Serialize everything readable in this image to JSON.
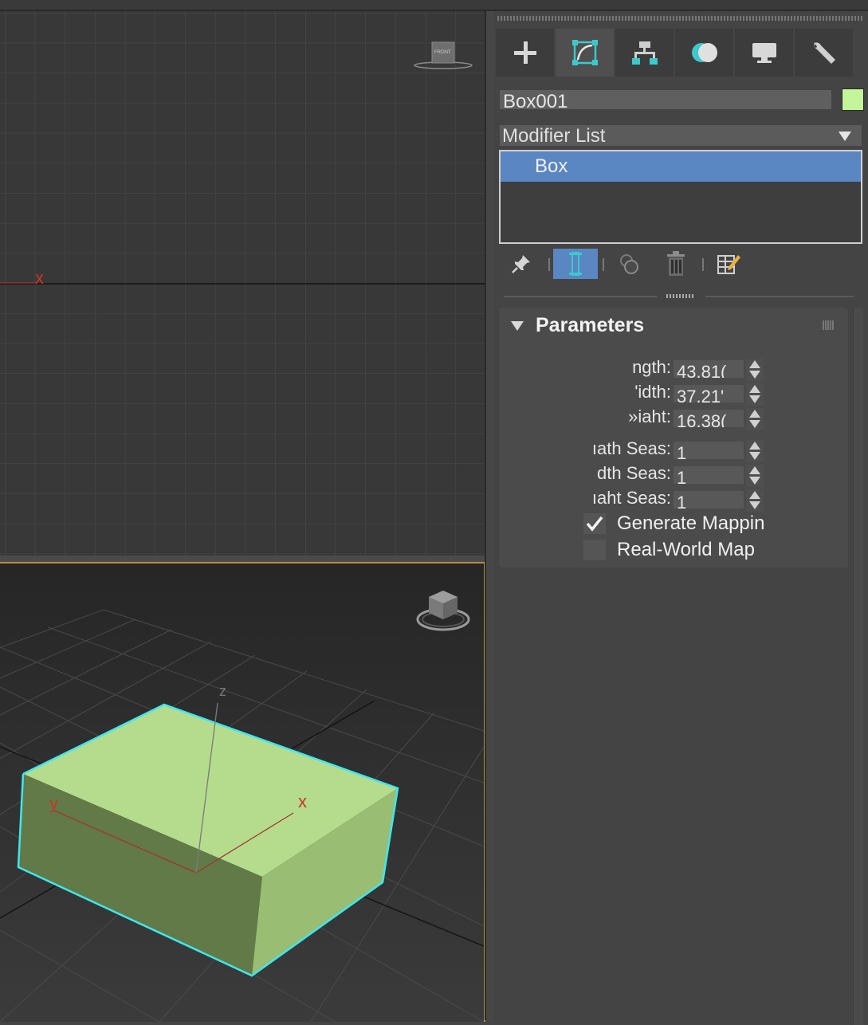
{
  "command_panel": {
    "tabs": [
      {
        "name": "create",
        "icon": "plus-icon"
      },
      {
        "name": "modify",
        "icon": "modify-icon"
      },
      {
        "name": "hierarchy",
        "icon": "hierarchy-icon"
      },
      {
        "name": "motion",
        "icon": "motion-icon"
      },
      {
        "name": "display",
        "icon": "display-icon"
      },
      {
        "name": "utilities",
        "icon": "wrench-icon"
      }
    ],
    "active_tab": "modify",
    "object_name": "Box001",
    "object_color": "#c5f59a",
    "modifier_list_label": "Modifier List",
    "stack": [
      "Box"
    ],
    "stack_tools": [
      "pin-icon",
      "show-end-result-icon",
      "make-unique-icon",
      "remove-modifier-icon",
      "configure-modifier-sets-icon"
    ]
  },
  "parameters": {
    "title": "Parameters",
    "fields": [
      {
        "label": "ngth:",
        "value": "43.81("
      },
      {
        "label": "'idth:",
        "value": "37.21'"
      },
      {
        "label": "»iaht:",
        "value": "16.38("
      }
    ],
    "segs": [
      {
        "label": "ıath Seas:",
        "value": "1"
      },
      {
        "label": "dth Seas:",
        "value": "1"
      },
      {
        "label": "ıaht Seas:",
        "value": "1"
      }
    ],
    "checkboxes": [
      {
        "label": "Generate Mappin",
        "checked": true
      },
      {
        "label": "Real-World Map",
        "checked": false
      }
    ]
  },
  "viewports": {
    "front": {
      "viewcube_label": "FRONT",
      "axis_x": "x"
    },
    "perspective": {
      "axis_x": "x",
      "axis_y": "y",
      "axis_z": "z"
    }
  },
  "colors": {
    "active_viewport_border": "#b08f3c",
    "selection_highlight": "#5a86c2",
    "box_fill": "#b4dc8c",
    "selection_edges": "#40e6ef"
  }
}
